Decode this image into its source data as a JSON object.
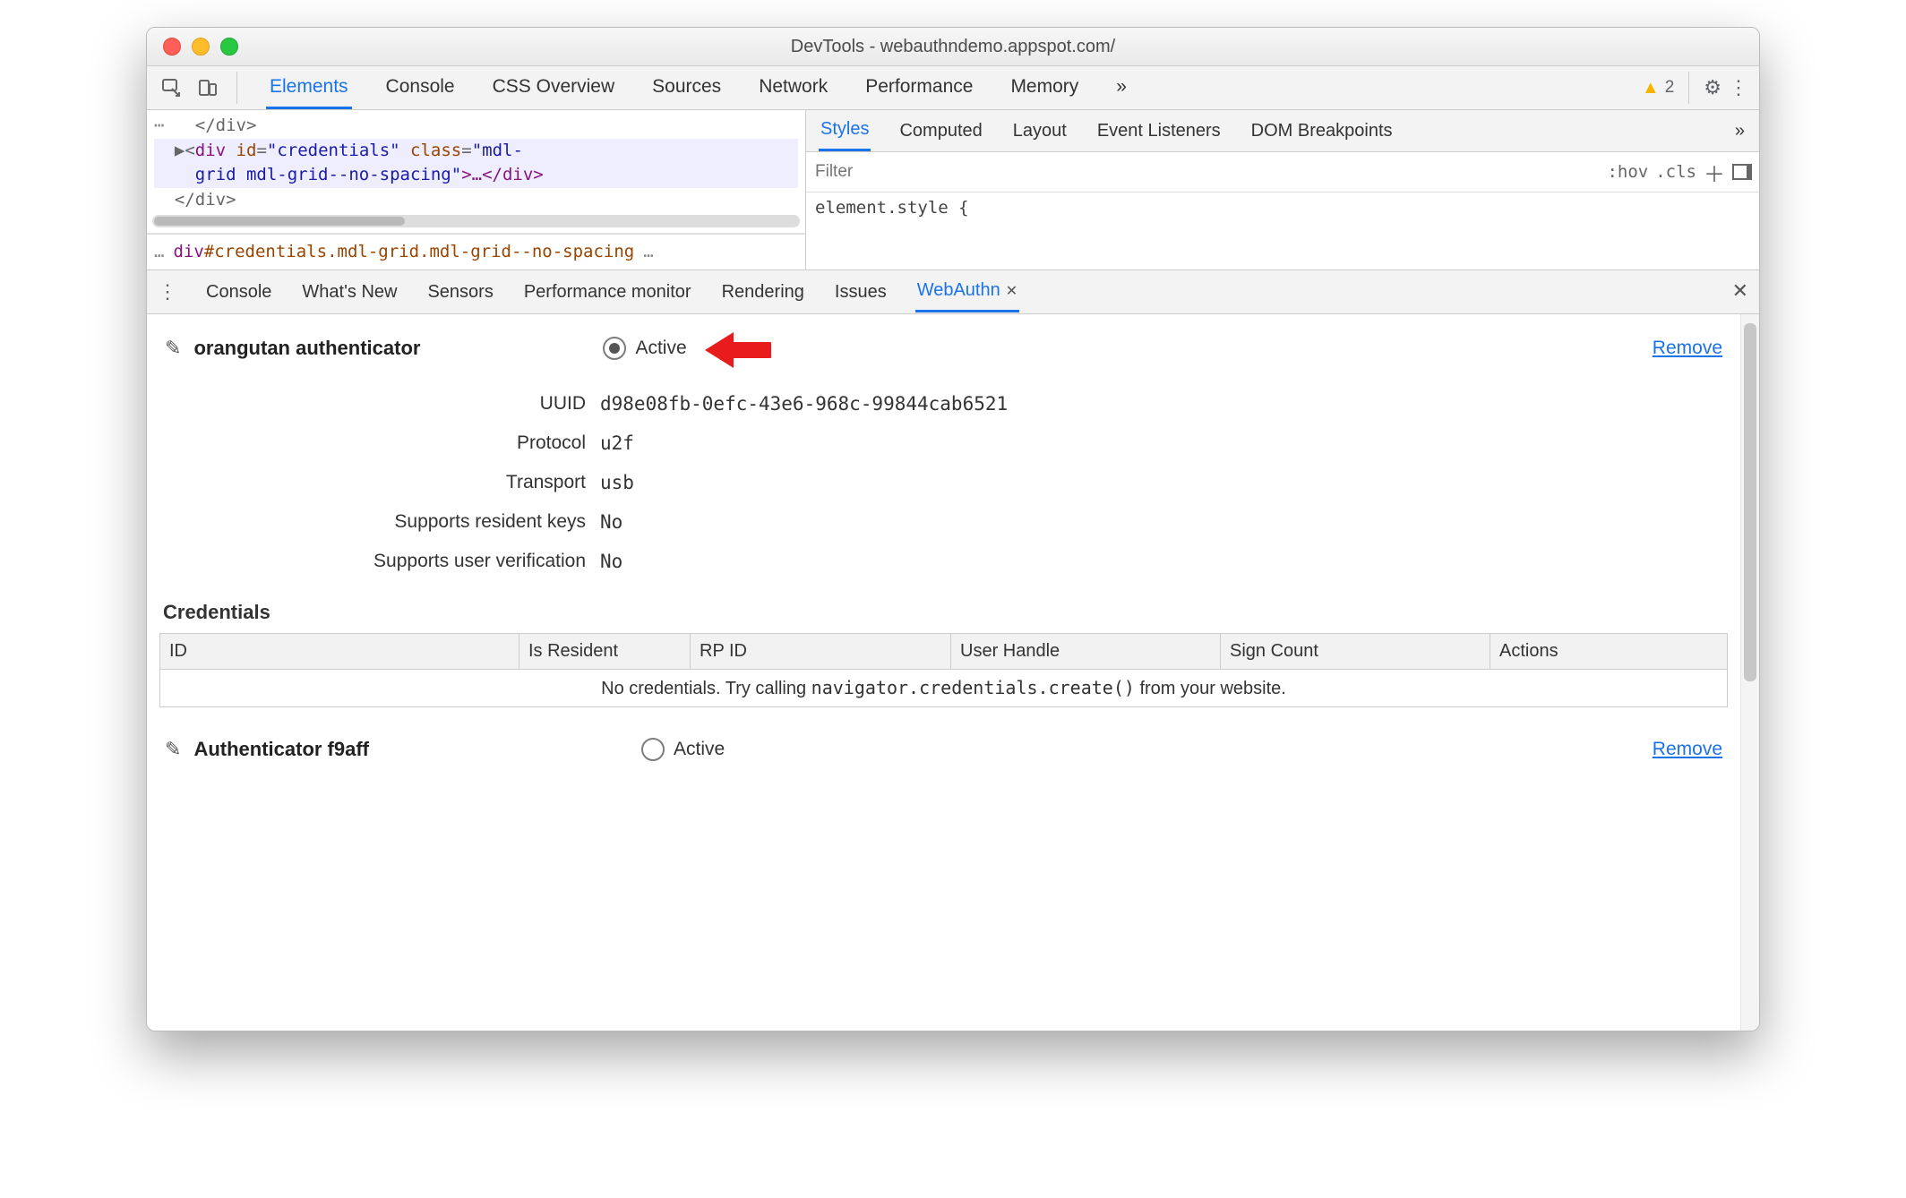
{
  "window_title": "DevTools - webauthndemo.appspot.com/",
  "main_tabs": {
    "elements": "Elements",
    "console": "Console",
    "cssov": "CSS Overview",
    "sources": "Sources",
    "network": "Network",
    "performance": "Performance",
    "memory": "Memory",
    "more": "»"
  },
  "warnings_count": "2",
  "dom": {
    "l0": "   </div>",
    "l1_lead": "  ▶",
    "l1_open": "<",
    "l1_tag": "div",
    "l1_a1n": " id",
    "l1_a1v": "\"credentials\"",
    "l1_a2n": " class",
    "l1_a2v": "\"mdl-",
    "l2_val": "grid mdl-grid--no-spacing\"",
    "l2_close": ">…</div>",
    "l3": "  </div>"
  },
  "breadcrumb": {
    "ell_left": "…",
    "tag": "div",
    "id": "#credentials",
    "cls": ".mdl-grid.mdl-grid--no-spacing",
    "ell_right": "…"
  },
  "subtabs": {
    "styles": "Styles",
    "computed": "Computed",
    "layout": "Layout",
    "listeners": "Event Listeners",
    "dombp": "DOM Breakpoints",
    "more": "»"
  },
  "styles_panel": {
    "filter_placeholder": "Filter",
    "hov": ":hov",
    "cls": ".cls",
    "rule": "element.style {"
  },
  "drawer_tabs": {
    "console": "Console",
    "whatsnew": "What's New",
    "sensors": "Sensors",
    "perfmon": "Performance monitor",
    "rendering": "Rendering",
    "issues": "Issues",
    "webauthn": "WebAuthn"
  },
  "authenticators": [
    {
      "name": "orangutan authenticator",
      "active_label": "Active",
      "active_checked": true,
      "remove": "Remove",
      "props": {
        "uuid_label": "UUID",
        "uuid": "d98e08fb-0efc-43e6-968c-99844cab6521",
        "protocol_label": "Protocol",
        "protocol": "u2f",
        "transport_label": "Transport",
        "transport": "usb",
        "resident_label": "Supports resident keys",
        "resident": "No",
        "uv_label": "Supports user verification",
        "uv": "No"
      }
    },
    {
      "name": "Authenticator f9aff",
      "active_label": "Active",
      "active_checked": false,
      "remove": "Remove"
    }
  ],
  "credentials": {
    "heading": "Credentials",
    "cols": {
      "id": "ID",
      "resident": "Is Resident",
      "rpid": "RP ID",
      "user": "User Handle",
      "sign": "Sign Count",
      "actions": "Actions"
    },
    "empty_pre": "No credentials. Try calling ",
    "empty_code": "navigator.credentials.create()",
    "empty_post": " from your website."
  }
}
